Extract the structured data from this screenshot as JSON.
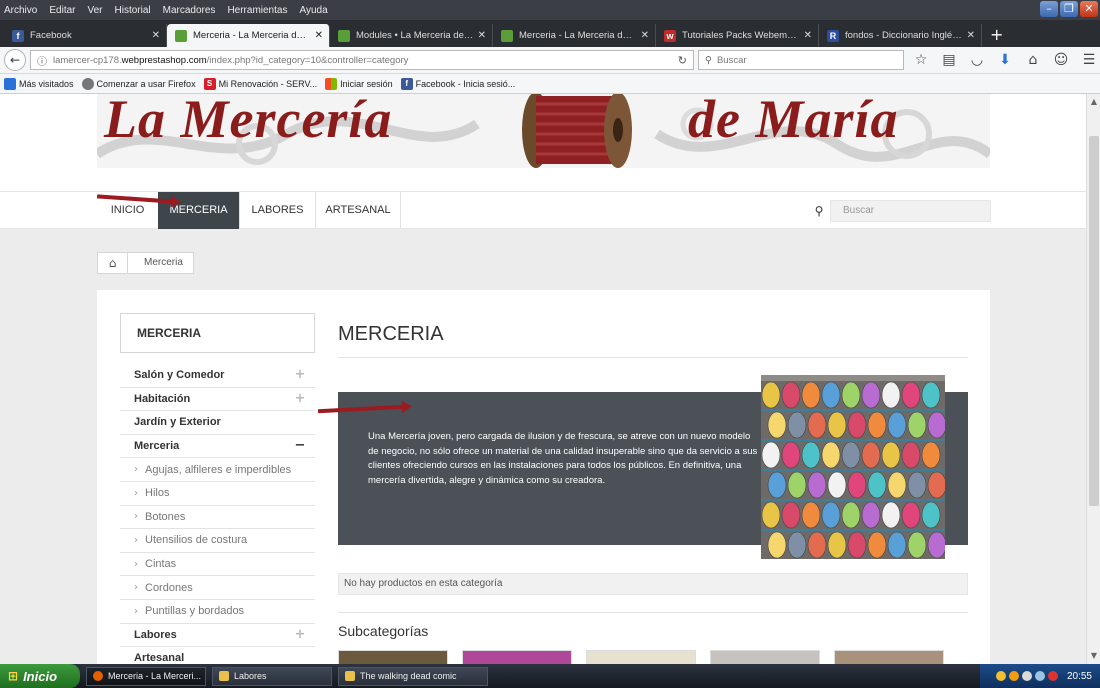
{
  "menubar": [
    "Archivo",
    "Editar",
    "Ver",
    "Historial",
    "Marcadores",
    "Herramientas",
    "Ayuda"
  ],
  "tabs": [
    {
      "title": "Facebook",
      "icon": "facebook-icon",
      "color": "#3b5998"
    },
    {
      "title": "Merceria - La Merceria de Maria",
      "icon": "prestashop-icon",
      "color": "#5a9e3a"
    },
    {
      "title": "Modules • La Merceria de Maria",
      "icon": "prestashop-icon",
      "color": "#5a9e3a"
    },
    {
      "title": "Merceria - La Merceria de Maria",
      "icon": "prestashop-icon",
      "color": "#5a9e3a"
    },
    {
      "title": "Tutoriales Packs Webempresa...",
      "icon": "webempresa-icon",
      "color": "#c02a2a"
    },
    {
      "title": "fondos - Diccionario Inglés-Esp...",
      "icon": "wordreference-icon",
      "color": "#2a4da0"
    }
  ],
  "address": {
    "host_prefix": "lamercer-cp178.",
    "host_main": "webprestashop.com",
    "path": "/index.php?id_category=10&controller=category"
  },
  "search_placeholder": "Buscar",
  "bookmarks": [
    {
      "label": "Más visitados",
      "color": "#2a71d8"
    },
    {
      "label": "Comenzar a usar Firefox",
      "color": "#777"
    },
    {
      "label": "Mi Renovación - SERV...",
      "color": "#d81e2a"
    },
    {
      "label": "Iniciar sesión",
      "color": "#f25022"
    },
    {
      "label": "Facebook - Inicia sesió...",
      "color": "#3b5998"
    }
  ],
  "banner": {
    "logo_left": "La Mercería",
    "logo_right": "de María"
  },
  "nav": {
    "inicio": "INICIO",
    "merceria": "MERCERIA",
    "labores": "LABORES",
    "artesanal": "ARTESANAL",
    "search_placeholder": "Buscar"
  },
  "breadcrumb": {
    "current": "Merceria"
  },
  "sidebar": {
    "title": "MERCERIA",
    "items": [
      {
        "label": "Salón y Comedor",
        "type": "top",
        "toggle": "+"
      },
      {
        "label": "Habitación",
        "type": "top",
        "toggle": "+"
      },
      {
        "label": "Jardín y Exterior",
        "type": "top",
        "toggle": ""
      },
      {
        "label": "Merceria",
        "type": "top",
        "toggle": "−"
      },
      {
        "label": "Agujas, alfileres e imperdibles",
        "type": "sub",
        "toggle": ""
      },
      {
        "label": "Hilos",
        "type": "sub",
        "toggle": ""
      },
      {
        "label": "Botones",
        "type": "sub",
        "toggle": ""
      },
      {
        "label": "Utensilios de costura",
        "type": "sub",
        "toggle": ""
      },
      {
        "label": "Cintas",
        "type": "sub",
        "toggle": ""
      },
      {
        "label": "Cordones",
        "type": "sub",
        "toggle": ""
      },
      {
        "label": "Puntillas y bordados",
        "type": "sub",
        "toggle": ""
      },
      {
        "label": "Labores",
        "type": "top",
        "toggle": "+"
      },
      {
        "label": "Artesanal",
        "type": "top",
        "toggle": ""
      }
    ]
  },
  "category": {
    "title": "MERCERIA",
    "description": "Una Mercería joven, pero cargada de ilusion y de frescura, se atreve con un nuevo modelo de negocio, no sólo ofrece un material de una calidad insuperable sino que da servicio a sus clientes ofreciendo cursos en las instalaciones para todos los públicos. En definitiva, una mercería divertida, alegre y dinámica como su creadora.",
    "no_products": "No hay productos en esta categoría",
    "subcategories_title": "Subcategorías"
  },
  "taskbar": {
    "start": "Inicio",
    "tasks": [
      {
        "label": "Merceria - La Merceri...",
        "active": true,
        "color": "#e66000"
      },
      {
        "label": "Labores",
        "active": false,
        "color": "#e8c04a"
      },
      {
        "label": "The walking dead comic",
        "active": false,
        "color": "#e8c04a"
      }
    ],
    "clock": "20:55"
  },
  "colors": {
    "brand": "#8a1c1c",
    "nav_active": "#3f464b",
    "arrow": "#9b1b21"
  }
}
